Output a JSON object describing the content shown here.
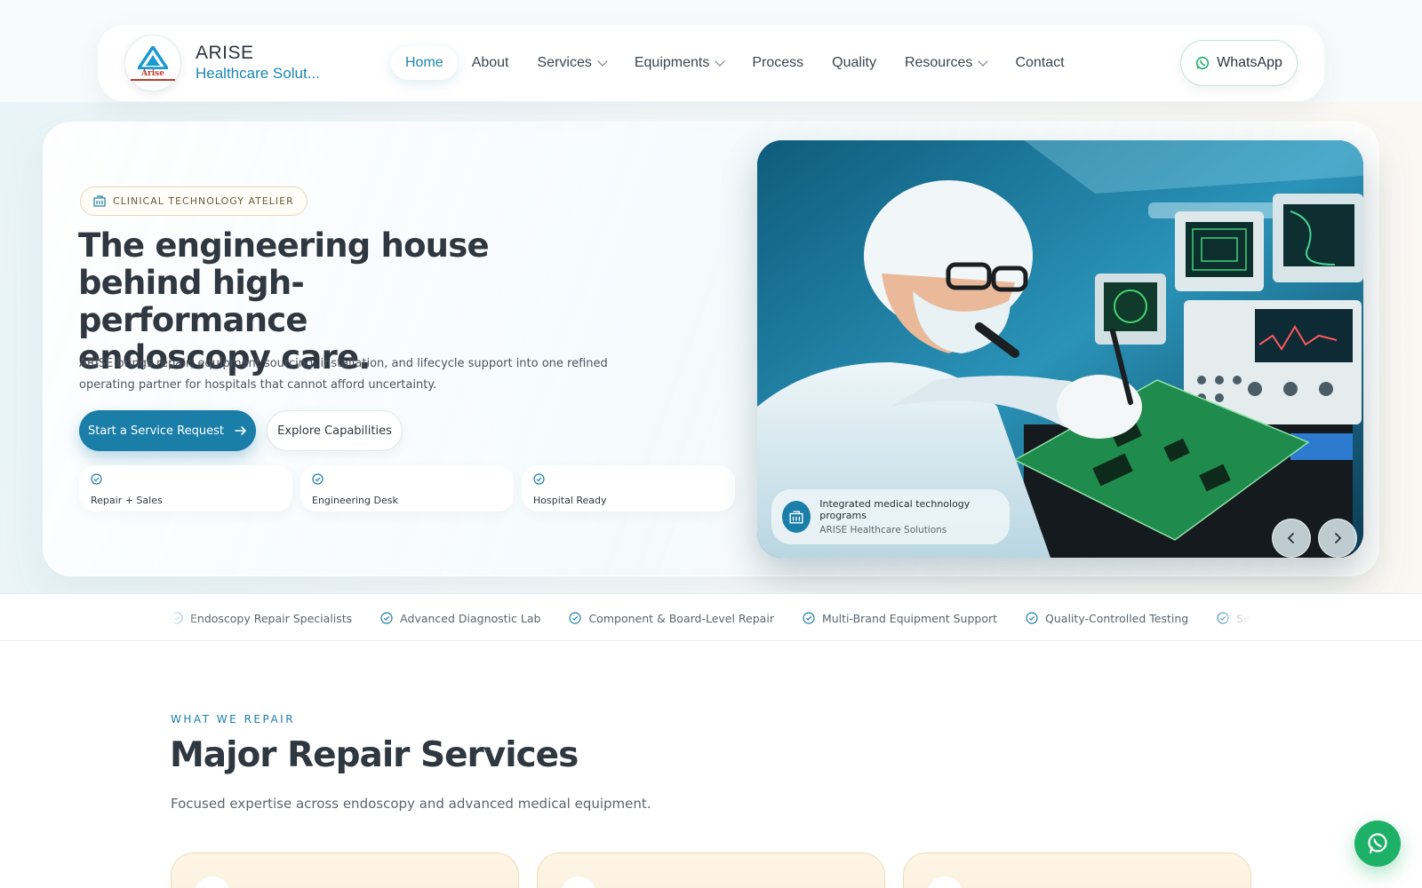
{
  "brand": {
    "logo_text": "Arise",
    "name": "ARISE",
    "subtitle": "Healthcare Solut...",
    "accent_color": "#1a7ea8"
  },
  "nav": {
    "items": [
      {
        "label": "Home",
        "active": true,
        "dropdown": false
      },
      {
        "label": "About",
        "active": false,
        "dropdown": false
      },
      {
        "label": "Services",
        "active": false,
        "dropdown": true
      },
      {
        "label": "Equipments",
        "active": false,
        "dropdown": true
      },
      {
        "label": "Process",
        "active": false,
        "dropdown": false
      },
      {
        "label": "Quality",
        "active": false,
        "dropdown": false
      },
      {
        "label": "Resources",
        "active": false,
        "dropdown": true
      },
      {
        "label": "Contact",
        "active": false,
        "dropdown": false
      }
    ],
    "whatsapp_label": "WhatsApp",
    "whatsapp_icon": "whatsapp-icon"
  },
  "hero": {
    "eyebrow": "CLINICAL TECHNOLOGY ATELIER",
    "eyebrow_icon": "building-icon",
    "title": "The engineering house behind high-performance endoscopy care.",
    "description": "ARISE brings repair, equipment sourcing, installation, and lifecycle support into one refined operating partner for hospitals that cannot afford uncertainty.",
    "primary_cta": "Start a Service Request",
    "secondary_cta": "Explore Capabilities",
    "features": [
      {
        "label": "Repair + Sales",
        "icon": "check-circle-icon"
      },
      {
        "label": "Engineering Desk",
        "icon": "check-circle-icon"
      },
      {
        "label": "Hospital Ready",
        "icon": "check-circle-icon"
      }
    ],
    "image_alt": "Technician in lab coat soldering a green circuit board with electronic test equipment behind",
    "caption_title": "Integrated medical technology programs",
    "caption_subtitle": "ARISE Healthcare Solutions"
  },
  "ticker": {
    "items": [
      "Endoscopy Repair Specialists",
      "Advanced Diagnostic Lab",
      "Component & Board-Level Repair",
      "Multi-Brand Equipment Support",
      "Quality-Controlled Testing",
      "Service Warra"
    ]
  },
  "services": {
    "eyebrow": "WHAT WE REPAIR",
    "title": "Major Repair Services",
    "subtitle": "Focused expertise across endoscopy and advanced medical equipment."
  },
  "colors": {
    "primary": "#1a7ea8",
    "whatsapp": "#1db168",
    "card_warm": "#fbf0dc"
  }
}
